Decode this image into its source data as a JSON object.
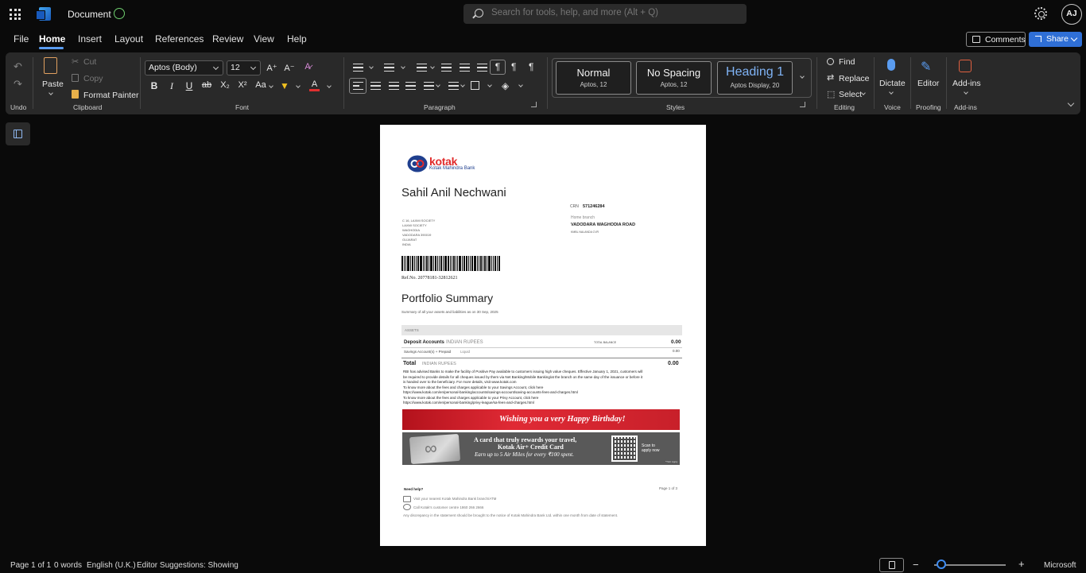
{
  "titlebar": {
    "doc_title": "Document",
    "search_placeholder": "Search for tools, help, and more (Alt + Q)",
    "avatar_initials": "AJ"
  },
  "menu": {
    "items": [
      "File",
      "Home",
      "Insert",
      "Layout",
      "References",
      "Review",
      "View",
      "Help"
    ],
    "active": "Home",
    "comments_label": "Comments",
    "share_label": "Share"
  },
  "ribbon": {
    "undo_group": "Undo",
    "clipboard": {
      "paste": "Paste",
      "cut": "Cut",
      "copy": "Copy",
      "format_painter": "Format Painter",
      "label": "Clipboard"
    },
    "font": {
      "family": "Aptos (Body)",
      "size": "12",
      "label": "Font"
    },
    "paragraph": {
      "label": "Paragraph"
    },
    "styles": {
      "label": "Styles",
      "items": [
        {
          "name": "Normal",
          "sub": "Aptos, 12"
        },
        {
          "name": "No Spacing",
          "sub": "Aptos, 12"
        },
        {
          "name": "Heading 1",
          "sub": "Aptos Display, 20"
        }
      ]
    },
    "editing": {
      "find": "Find",
      "replace": "Replace",
      "select": "Select",
      "label": "Editing"
    },
    "voice": {
      "dictate": "Dictate",
      "label": "Voice"
    },
    "proofing": {
      "editor": "Editor",
      "label": "Proofing"
    },
    "addins": {
      "addins": "Add-ins",
      "label": "Add-ins"
    }
  },
  "document": {
    "bank_name": "kotak",
    "bank_sub": "Kotak Mahindra Bank",
    "customer_name": "Sahil Anil Nechwani",
    "crn_label": "CRN",
    "crn_value": "571246284",
    "home_branch_label": "Home branch",
    "home_branch_value": "VADODARA WAGHODIA ROAD",
    "branch_small": "KMBL NALANDA CVR",
    "address_lines": [
      "C 16, LAXMI SOCIETY",
      "LAXMI SOCIETY",
      "WAGHODIA",
      "VADODARA 390019",
      "GUJARAT",
      "INDIA"
    ],
    "ref_no": "Ref.No. 20778181-32812621",
    "portfolio_title": "Portfolio Summary",
    "portfolio_sub": "Summary of all your assets and liabilities as on   30 Sep, 2025",
    "assets_label": "ASSETS",
    "deposit_label": "Deposit Accounts",
    "deposit_currency": "INDIAN RUPEES",
    "total_balance_label": "TOTAL BALANCE",
    "deposit_value": "0.00",
    "savings_label": "Savings Account(s) + Prepaid",
    "savings_sub": "Liquid",
    "savings_value": "0.00",
    "total_label": "Total",
    "total_currency": "INDIAN RUPEES",
    "total_value": "0.00",
    "notice_lines": [
      "RBI has advised Banks to make the facility of Positive Pay available to customers issuing high value cheques. Effective January 1, 2021, customers will",
      "be required to provide details for all cheques issued by them via Net Banking/Mobile Banking/at the branch on the same day of the issuance or before it",
      "is handed over to the beneficiary. For more details, visit www.kotak.com",
      "To know more about the fees and charges applicable to your Savings Account, click here",
      "https://www.kotak.com/en/personal-banking/accounts/savings-account/saving-accounts-fees-and-charges.html",
      "To know more about the fees and charges applicable to your Privy Account, click here",
      "https://www.kotak.com/en/personal-banking/privy-league/sa-fees-and-charges.html"
    ],
    "birthday_banner": "Wishing you a very Happy Birthday!",
    "card_banner_l1": "A card that truly rewards your travel,",
    "card_banner_l2": "Kotak Air+ Credit Card",
    "card_banner_l3": "Earn up to 5 Air Miles for every ₹100 spent.",
    "scan_l1": "Scan to",
    "scan_l2": "apply now",
    "tnc": "*T&C Apply",
    "need_help": "Need help?",
    "page_no": "Page 1 of 3",
    "help_branch": "Visit your nearest Kotak Mahindra Bank branch/ATM",
    "help_call": "Call Kotak's customer centre 1860 266 2666",
    "disclaimer": "Any discrepancy in the statement should be brought to the notice of Kotak Mahindra Bank Ltd. within one month from date of statement."
  },
  "status": {
    "page": "Page 1 of 1",
    "words": "0 words",
    "language": "English (U.K.)",
    "editor": "Editor Suggestions: Showing",
    "brand": "Microsoft",
    "zoom_fraction": 0.1
  }
}
